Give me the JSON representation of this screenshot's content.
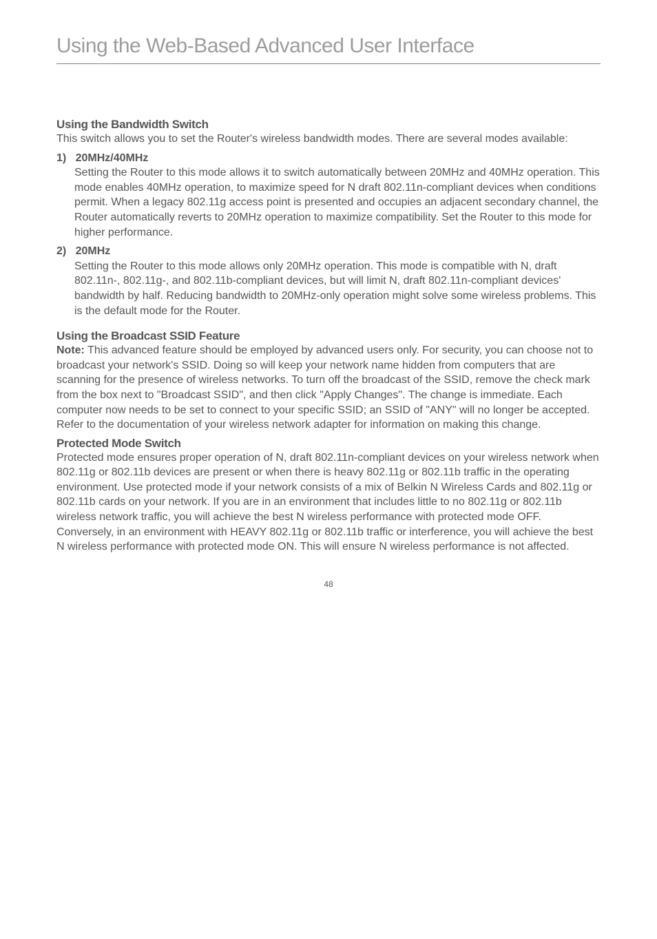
{
  "chapter": {
    "title": "Using the Web-Based Advanced User Interface"
  },
  "section1": {
    "title": "Using the Bandwidth Switch",
    "intro": "This switch allows you to set the Router's wireless bandwidth modes. There are several modes available:",
    "items": [
      {
        "num": "1)",
        "label": "20MHz/40MHz",
        "body": "Setting the Router to this mode allows it to switch automatically between 20MHz and 40MHz operation. This mode enables 40MHz operation, to maximize speed for N draft 802.11n-compliant devices when conditions permit. When a legacy 802.11g access point is presented and occupies an adjacent secondary channel, the Router automatically reverts to 20MHz operation to maximize compatibility. Set the Router to this mode for higher performance."
      },
      {
        "num": "2)",
        "label": "20MHz",
        "body": "Setting the Router to this mode allows only 20MHz operation. This mode is compatible with N, draft 802.11n-, 802.11g-, and 802.11b-compliant devices, but will limit N, draft 802.11n-compliant devices' bandwidth by half. Reducing bandwidth to 20MHz-only operation might solve some wireless problems. This is the default mode for the Router."
      }
    ]
  },
  "section2": {
    "title": "Using the Broadcast SSID Feature",
    "note_label": "Note:",
    "body": " This advanced feature should be employed by advanced users only. For security, you can choose not to broadcast your network's SSID. Doing so will keep your network name hidden from computers that are scanning for the presence of wireless networks. To turn off the broadcast of the SSID, remove the check mark from the box next to \"Broadcast SSID\", and then click \"Apply Changes\". The change is immediate. Each computer now needs to be set to connect to your specific SSID; an SSID of \"ANY\" will no longer be accepted. Refer to the documentation of your wireless network adapter for information on making this change."
  },
  "section3": {
    "title": "Protected Mode Switch",
    "body": "Protected mode ensures proper operation of N, draft 802.11n-compliant devices on your wireless network when 802.11g or 802.11b devices are present or when there is heavy 802.11g or 802.11b traffic in the operating environment. Use protected mode if your network consists of a mix of Belkin N Wireless Cards and 802.11g or 802.11b cards on your network. If you are in an environment that includes little to no 802.11g or 802.11b wireless network traffic, you will achieve the best N wireless performance with protected mode OFF. Conversely, in an environment with HEAVY 802.11g or 802.11b traffic or interference, you will achieve the best N wireless performance with protected mode ON. This will ensure N wireless performance is not affected."
  },
  "page_number": "48"
}
